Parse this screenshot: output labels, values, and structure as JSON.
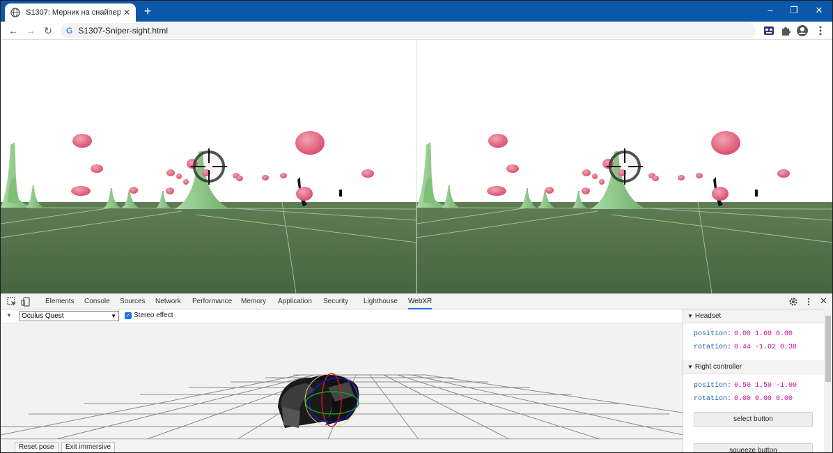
{
  "browser": {
    "tab_title": "S1307: Мерник на снайпер",
    "new_tab": "+",
    "url": "S1307-Sniper-sight.html",
    "window_controls": {
      "minimize": "–",
      "maximize": "❐",
      "close": "✕"
    },
    "nav": {
      "back": "←",
      "forward": "→",
      "reload": "↻"
    },
    "icons": [
      "webxr-extension-icon",
      "puzzle-extensions-icon",
      "profile-icon",
      "kebab-menu-icon"
    ]
  },
  "devtools": {
    "tabs": [
      "Elements",
      "Console",
      "Sources",
      "Network",
      "Performance",
      "Memory",
      "Application",
      "Security",
      "Lighthouse",
      "WebXR"
    ],
    "active_tab": "WebXR",
    "device": "Oculus Quest",
    "stereo_effect_label": "Stereo effect",
    "stereo_effect_checked": true,
    "buttons": {
      "reset_pose": "Reset pose",
      "exit_immersive": "Exit immersive"
    },
    "headset": {
      "title": "Headset",
      "position_label": "position:",
      "position": "0.00 1.60 0.00",
      "rotation_label": "rotation:",
      "rotation": "0.44 -1.02 0.38"
    },
    "right_controller": {
      "title": "Right controller",
      "position_label": "position:",
      "position": "0.50 1.50 -1.00",
      "rotation_label": "rotation:",
      "rotation": "0.00 0.00 0.00",
      "select_button": "select button",
      "squeeze_button": "squeeze button"
    }
  },
  "colors": {
    "titlebar": "#0b57ab",
    "sky": "#ffffff",
    "ground": "#4f6e46",
    "grass_spike": "#8fc98a",
    "balloon": "#e4607a",
    "accent": "#1a73e8"
  }
}
